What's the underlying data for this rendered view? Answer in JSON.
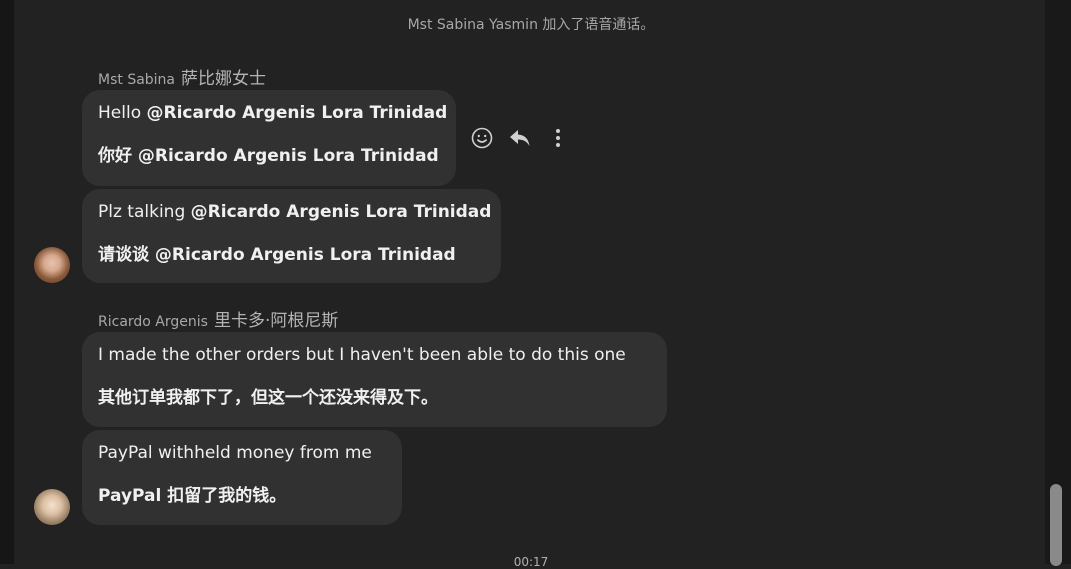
{
  "system": {
    "joined_text": "Mst Sabina Yasmin 加入了语音通话。"
  },
  "groups": [
    {
      "sender_name": "Mst Sabina",
      "sender_name_translated": "萨比娜女士",
      "messages": [
        {
          "original_prefix": "Hello ",
          "original_mention": "@Ricardo Argenis Lora Trinidad",
          "translated_prefix": "你好 ",
          "translated_mention": "@Ricardo Argenis Lora Trinidad"
        },
        {
          "original_prefix": "Plz talking ",
          "original_mention": "@Ricardo Argenis Lora Trinidad",
          "translated_prefix": "请谈谈 ",
          "translated_mention": "@Ricardo Argenis Lora Trinidad"
        }
      ]
    },
    {
      "sender_name": "Ricardo Argenis",
      "sender_name_translated": "里卡多·阿根尼斯",
      "messages": [
        {
          "original": "I made the other orders but I haven't been able to do this one",
          "translated": "其他订单我都下了，但这一个还没来得及下。"
        },
        {
          "original": "PayPal withheld money from me",
          "translated": "PayPal 扣留了我的钱。"
        }
      ]
    }
  ],
  "message_actions": {
    "react_icon": "smiley-icon",
    "reply_icon": "reply-icon",
    "more_icon": "more-vertical-icon"
  },
  "timestamp": "00:17"
}
